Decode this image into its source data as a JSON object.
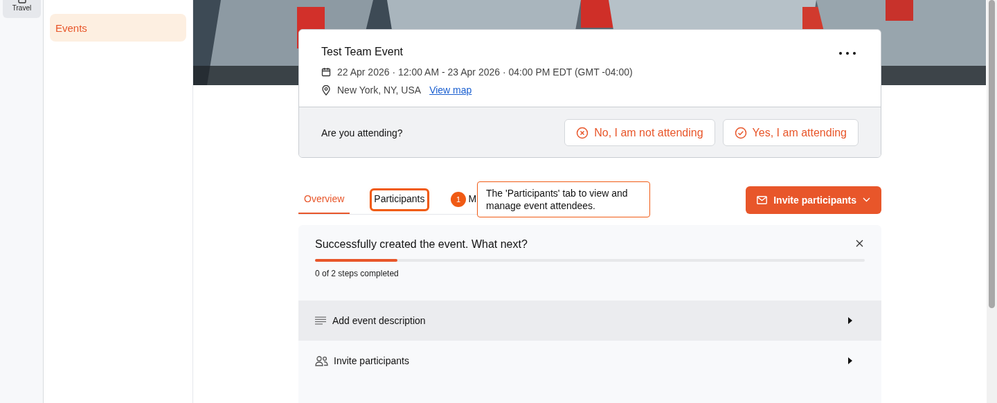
{
  "rail": {
    "items": [
      {
        "label": "Travel",
        "selected": true
      }
    ]
  },
  "sidebar": {
    "items": [
      {
        "label": "Events",
        "selected": true
      }
    ]
  },
  "event": {
    "title": "Test Team Event",
    "date": "22 Apr 2026 · 12:00 AM - 23 Apr 2026 · 04:00 PM EDT (GMT -04:00)",
    "location": "New York, NY, USA",
    "map_link": "View map",
    "rsvp": {
      "question": "Are you attending?",
      "buttons": [
        {
          "label": "No, I am not attending",
          "kind": "no"
        },
        {
          "label": "Yes, I am attending",
          "kind": "yes"
        }
      ]
    }
  },
  "tabs": [
    {
      "label": "Overview",
      "selected": true,
      "highlighted": false
    },
    {
      "label": "Participants",
      "selected": false,
      "highlighted": true
    },
    {
      "label": "M",
      "selected": false,
      "highlighted": false
    }
  ],
  "annotation": {
    "number": "1",
    "text": "The 'Participants' tab to view and manage event attendees."
  },
  "invite_button": {
    "label": "Invite participants"
  },
  "checklist": {
    "title": "Successfully created the event. What next?",
    "level": 0.15,
    "progress": "0 of 2 steps completed",
    "steps": [
      {
        "label": "Add event description",
        "kind": "description",
        "selected": true
      },
      {
        "label": "Invite participants",
        "kind": "invite",
        "selected": false
      }
    ]
  }
}
